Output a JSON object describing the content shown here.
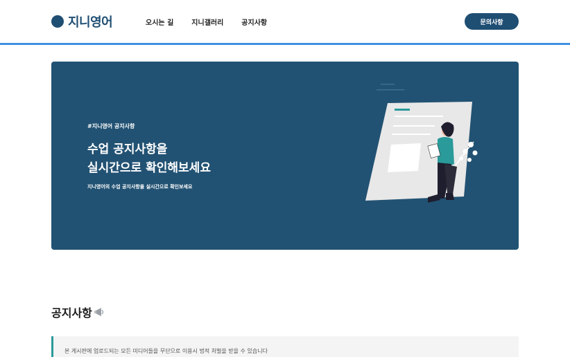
{
  "header": {
    "logo": "지니영어",
    "nav": [
      "오시는 길",
      "지니갤러리",
      "공지사항"
    ],
    "cta": "문의사항"
  },
  "hero": {
    "tag": "#지니영어 공지사항",
    "title_line1": "수업 공지사항을",
    "title_line2": "실시간으로 확인해보세요",
    "desc": "지니영어의 수업 공지사항을 실시간으로 확인보세요"
  },
  "section": {
    "title": "공지사항",
    "icon": "megaphone-icon"
  },
  "notice": {
    "text": "본 게시판에 업로드되는 모든 미디어들을 무단으로 이용시 법적 처벌을 받을 수 있습니다"
  },
  "colors": {
    "brand": "#1f4e73",
    "hero_bg": "#225273",
    "accent_line": "#3d8fe0",
    "notice_border": "#2a9a9a"
  }
}
